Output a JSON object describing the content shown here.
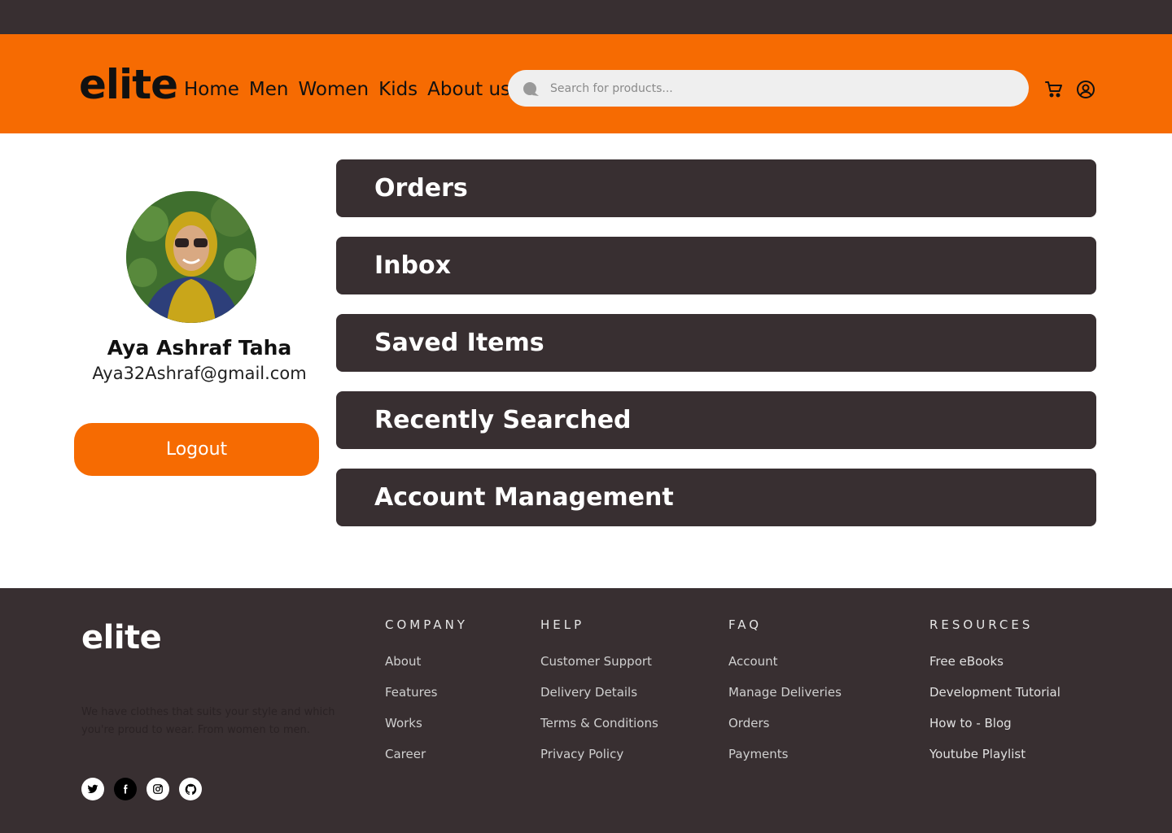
{
  "header": {
    "logo": "elite",
    "nav": [
      "Home",
      "Men",
      "Women",
      "Kids",
      "About us"
    ],
    "search_placeholder": "Search for products..."
  },
  "profile": {
    "name": "Aya Ashraf Taha",
    "email": "Aya32Ashraf@gmail.com",
    "logout_label": "Logout"
  },
  "menu": [
    "Orders",
    "Inbox",
    "Saved Items",
    "Recently Searched",
    "Account Management"
  ],
  "footer": {
    "logo": "elite",
    "description": "We have clothes that suits your style and which you're proud to wear. From women to men.",
    "columns": [
      {
        "title": "COMPANY",
        "links": [
          "About",
          "Features",
          "Works",
          "Career"
        ]
      },
      {
        "title": "HELP",
        "links": [
          "Customer Support",
          "Delivery Details",
          "Terms & Conditions",
          "Privacy Policy"
        ]
      },
      {
        "title": "FAQ",
        "links": [
          "Account",
          "Manage Deliveries",
          "Orders",
          "Payments"
        ]
      },
      {
        "title": "RESOURCES",
        "links": [
          "Free eBooks",
          "Development Tutorial",
          "How to - Blog",
          "Youtube Playlist"
        ]
      }
    ],
    "socials": [
      "twitter-icon",
      "facebook-icon",
      "instagram-icon",
      "github-icon"
    ]
  },
  "colors": {
    "accent": "#f66b02",
    "dark": "#382f31"
  }
}
